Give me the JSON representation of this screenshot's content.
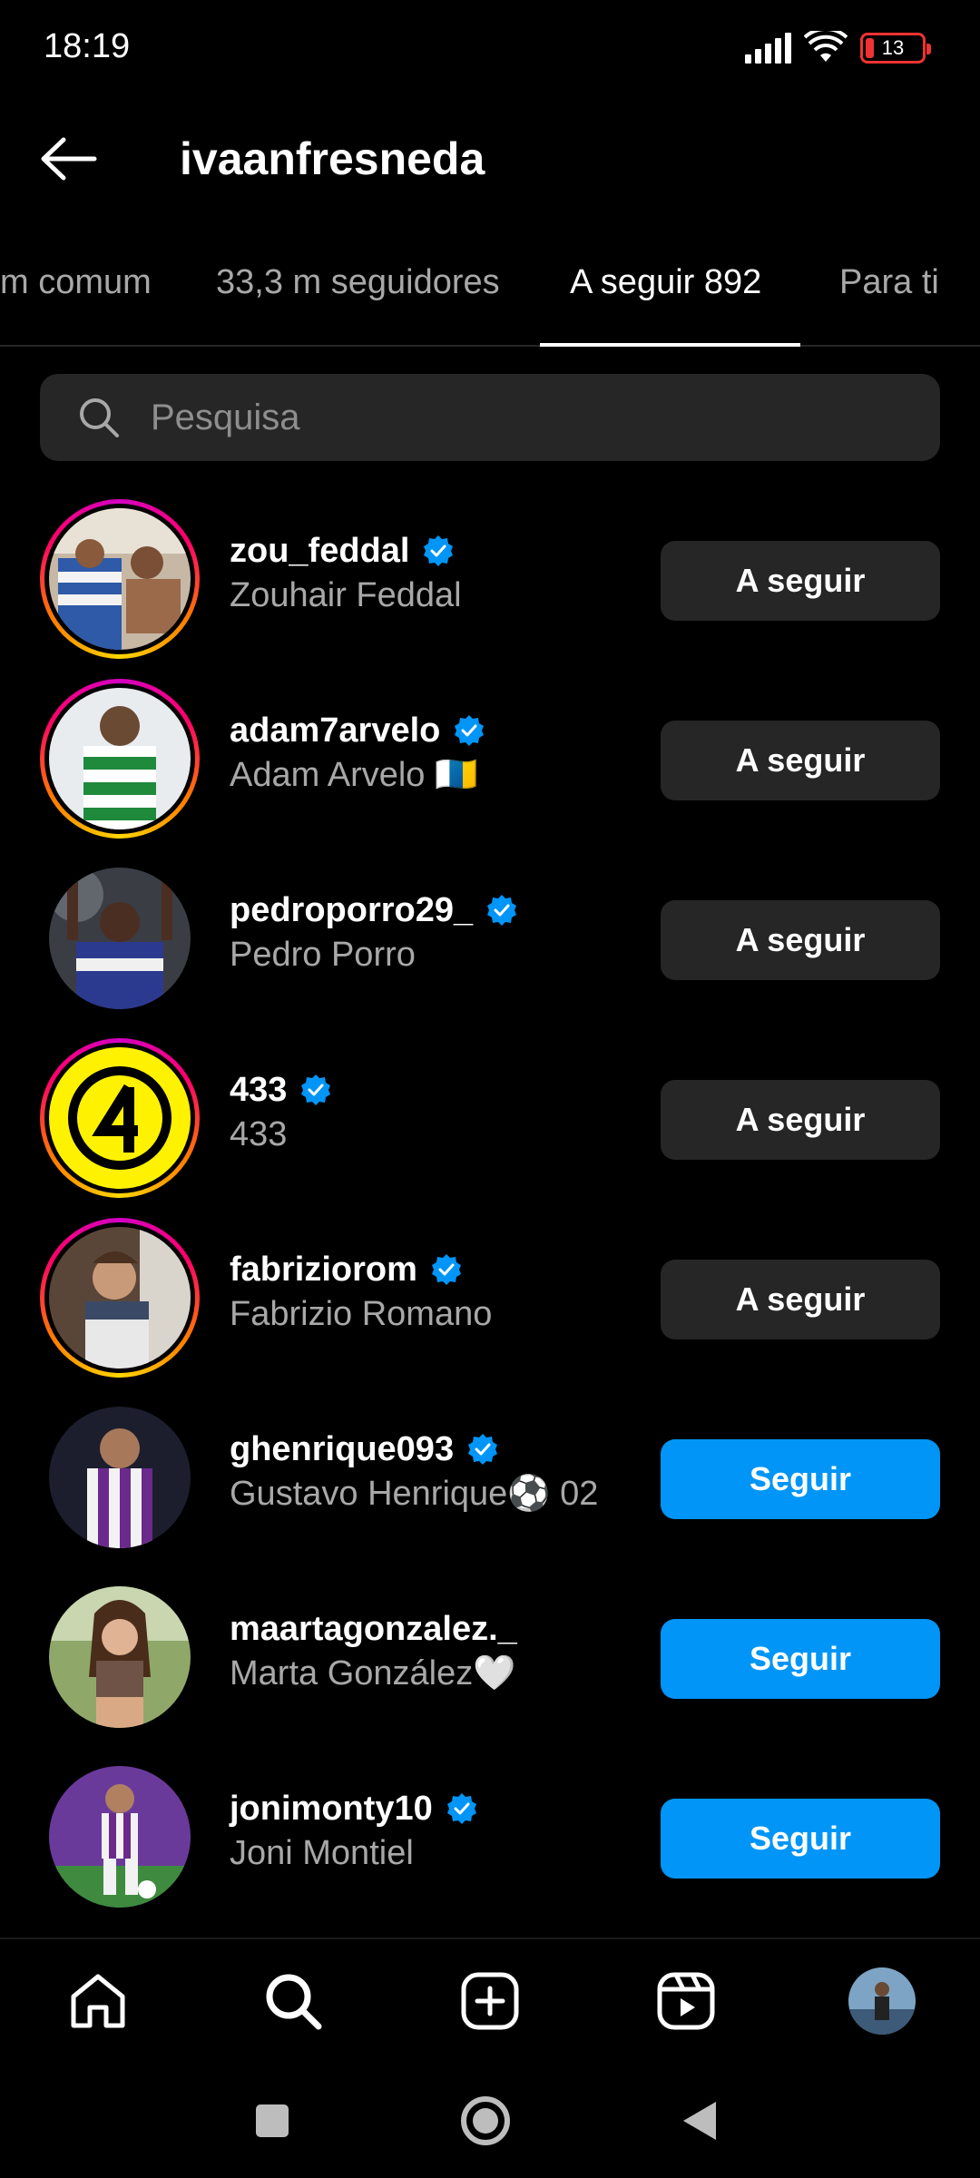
{
  "status_bar": {
    "time": "18:19",
    "battery": "13"
  },
  "header": {
    "title": "ivaanfresneda"
  },
  "tabs": [
    {
      "label": "m comum"
    },
    {
      "label": "33,3 m seguidores"
    },
    {
      "label": "A seguir 892"
    },
    {
      "label": "Para ti"
    }
  ],
  "search": {
    "placeholder": "Pesquisa"
  },
  "users": [
    {
      "username": "zou_feddal",
      "full_name": "Zouhair Feddal",
      "verified": true,
      "story": true,
      "button": "A seguir",
      "state": "following"
    },
    {
      "username": "adam7arvelo",
      "full_name": "Adam Arvelo 🇮🇨",
      "verified": true,
      "story": true,
      "button": "A seguir",
      "state": "following"
    },
    {
      "username": "pedroporro29_",
      "full_name": "Pedro Porro",
      "verified": true,
      "story": false,
      "button": "A seguir",
      "state": "following"
    },
    {
      "username": "433",
      "full_name": "433",
      "verified": true,
      "story": true,
      "button": "A seguir",
      "state": "following"
    },
    {
      "username": "fabriziorom",
      "full_name": "Fabrizio Romano",
      "verified": true,
      "story": true,
      "button": "A seguir",
      "state": "following"
    },
    {
      "username": "ghenrique093",
      "full_name": "Gustavo Henrique⚽ 02",
      "verified": true,
      "story": false,
      "button": "Seguir",
      "state": "follow"
    },
    {
      "username": "maartagonzalez._",
      "full_name": "Marta González🤍",
      "verified": false,
      "story": false,
      "button": "Seguir",
      "state": "follow"
    },
    {
      "username": "jonimonty10",
      "full_name": "Joni Montiel",
      "verified": true,
      "story": false,
      "button": "Seguir",
      "state": "follow"
    }
  ],
  "bottom_nav": [
    "home-icon",
    "search-icon",
    "create-icon",
    "reels-icon",
    "profile-avatar"
  ],
  "colors": {
    "follow_blue": "#0095f6",
    "following_gray": "#262626",
    "verified_blue": "#0095f6"
  }
}
